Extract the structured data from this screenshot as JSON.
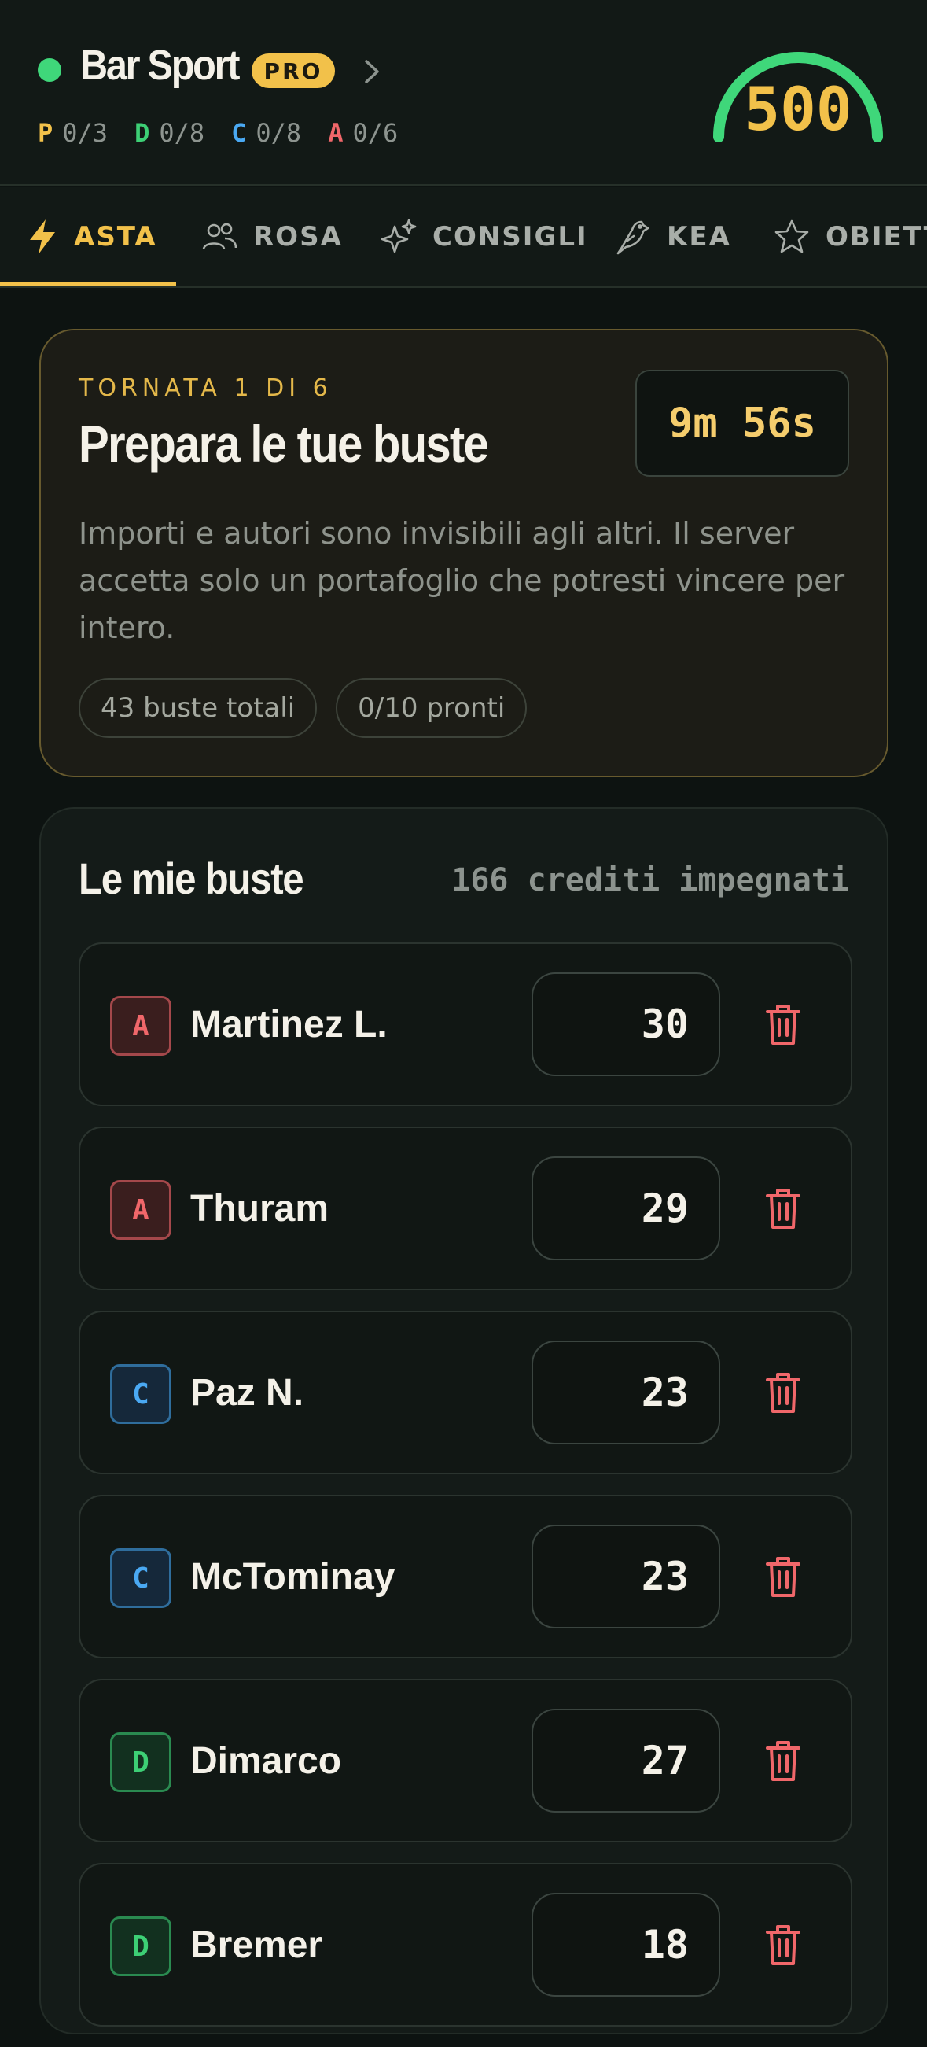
{
  "header": {
    "league_name": "Bar Sport",
    "badge": "PRO",
    "status_color": "#3fd77a",
    "credits": "500",
    "credits_gauge_fraction": 1.0,
    "role_counters": [
      {
        "letter": "P",
        "count": "0/3",
        "color": "#f2c14a"
      },
      {
        "letter": "D",
        "count": "0/8",
        "color": "#3dcf75"
      },
      {
        "letter": "C",
        "count": "0/8",
        "color": "#4aa9f3"
      },
      {
        "letter": "A",
        "count": "0/6",
        "color": "#f0676a"
      }
    ]
  },
  "tabs": [
    {
      "label": "ASTA",
      "icon": "lightning-icon",
      "active": true
    },
    {
      "label": "ROSA",
      "icon": "users-icon",
      "active": false
    },
    {
      "label": "CONSIGLI",
      "icon": "sparkles-icon",
      "active": false
    },
    {
      "label": "KEA",
      "icon": "bird-icon",
      "active": false
    },
    {
      "label": "OBIETTIVI",
      "icon": "star-icon",
      "active": false
    }
  ],
  "round": {
    "kicker": "TORNATA 1 DI 6",
    "title": "Prepara le tue buste",
    "timer": "9m 56s",
    "description": "Importi e autori sono invisibili agli altri. Il server accetta solo un portafoglio che potresti vincere per intero.",
    "chips": [
      "43 buste totali",
      "0/10 pronti"
    ]
  },
  "envelopes": {
    "title": "Le mie buste",
    "committed": "166 crediti impegnati",
    "bids": [
      {
        "role": "A",
        "player": "Martinez L.",
        "amount": "30"
      },
      {
        "role": "A",
        "player": "Thuram",
        "amount": "29"
      },
      {
        "role": "C",
        "player": "Paz N.",
        "amount": "23"
      },
      {
        "role": "C",
        "player": "McTominay",
        "amount": "23"
      },
      {
        "role": "D",
        "player": "Dimarco",
        "amount": "27"
      },
      {
        "role": "D",
        "player": "Bremer",
        "amount": "18"
      }
    ]
  },
  "colors": {
    "accent": "#f2c14a",
    "danger": "#f0676a",
    "background": "#0d1311"
  }
}
